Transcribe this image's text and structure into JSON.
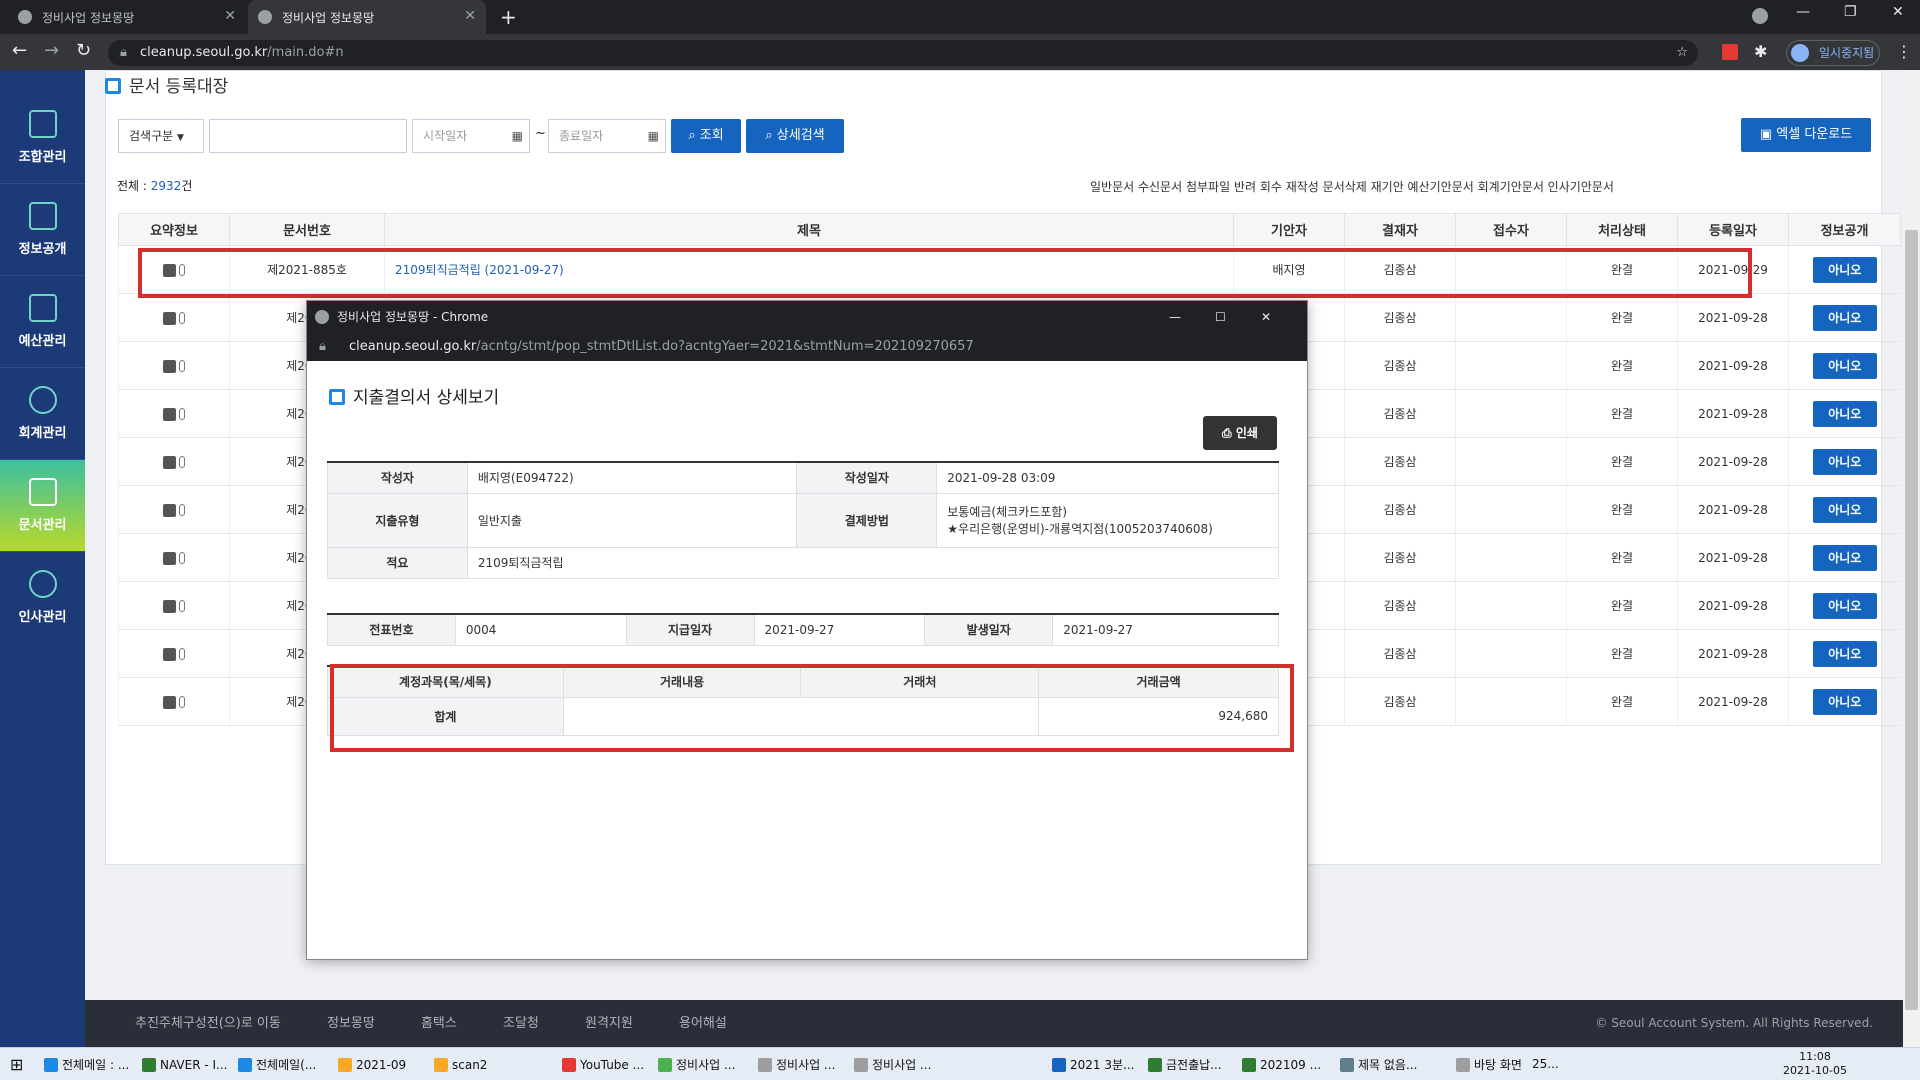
{
  "browser": {
    "tabs": [
      {
        "label": "정비사업 정보몽땅"
      },
      {
        "label": "정비사업 정보몽땅"
      }
    ],
    "url_host": "cleanup.seoul.go.kr",
    "url_path": "/main.do#n",
    "profile_label": "일시중지됨"
  },
  "sidebar": {
    "items": [
      {
        "label": "조합관리"
      },
      {
        "label": "정보공개"
      },
      {
        "label": "예산관리"
      },
      {
        "label": "회계관리"
      },
      {
        "label": "문서관리"
      },
      {
        "label": "인사관리"
      }
    ]
  },
  "page": {
    "title": "문서 등록대장",
    "search_type_label": "검색구분",
    "start_date_placeholder": "시작일자",
    "range_sep": "~",
    "end_date_placeholder": "종료일자",
    "search_button": "조회",
    "detail_search_button": "상세검색",
    "excel_button": "엑셀 다운로드",
    "total_prefix": "전체 : ",
    "total_count": "2932",
    "total_suffix": "건",
    "legend": "일반문서  수신문서  첨부파일  반려  회수  재작성  문서삭제  재기안  예산기안문서  회계기안문서  인사기안문서"
  },
  "table": {
    "headers": [
      "요약정보",
      "문서번호",
      "제목",
      "기안자",
      "결재자",
      "접수자",
      "처리상태",
      "등록일자",
      "정보공개"
    ],
    "rows": [
      {
        "doc_no": "제2021-885호",
        "title": "2109퇴직금적립 (2021-09-27)",
        "drafter": "배지영",
        "approver": "김종삼",
        "receiver": "",
        "status": "완결",
        "date": "2021-09-29",
        "public": "아니오"
      },
      {
        "doc_no": "제2021",
        "title": "",
        "drafter": "",
        "approver": "김종삼",
        "receiver": "",
        "status": "완결",
        "date": "2021-09-28",
        "public": "아니오"
      },
      {
        "doc_no": "제2021",
        "title": "",
        "drafter": "",
        "approver": "김종삼",
        "receiver": "",
        "status": "완결",
        "date": "2021-09-28",
        "public": "아니오"
      },
      {
        "doc_no": "제2021",
        "title": "",
        "drafter": "",
        "approver": "김종삼",
        "receiver": "",
        "status": "완결",
        "date": "2021-09-28",
        "public": "아니오"
      },
      {
        "doc_no": "제2021",
        "title": "",
        "drafter": "",
        "approver": "김종삼",
        "receiver": "",
        "status": "완결",
        "date": "2021-09-28",
        "public": "아니오"
      },
      {
        "doc_no": "제2021",
        "title": "",
        "drafter": "",
        "approver": "김종삼",
        "receiver": "",
        "status": "완결",
        "date": "2021-09-28",
        "public": "아니오"
      },
      {
        "doc_no": "제2021",
        "title": "",
        "drafter": "",
        "approver": "김종삼",
        "receiver": "",
        "status": "완결",
        "date": "2021-09-28",
        "public": "아니오"
      },
      {
        "doc_no": "제2021",
        "title": "",
        "drafter": "",
        "approver": "김종삼",
        "receiver": "",
        "status": "완결",
        "date": "2021-09-28",
        "public": "아니오"
      },
      {
        "doc_no": "제2021",
        "title": "",
        "drafter": "",
        "approver": "김종삼",
        "receiver": "",
        "status": "완결",
        "date": "2021-09-28",
        "public": "아니오"
      },
      {
        "doc_no": "제2021",
        "title": "",
        "drafter": "",
        "approver": "김종삼",
        "receiver": "",
        "status": "완결",
        "date": "2021-09-28",
        "public": "아니오"
      }
    ]
  },
  "popup": {
    "window_title": "정비사업 정보몽땅 - Chrome",
    "url_host": "cleanup.seoul.go.kr",
    "url_path": "/acntg/stmt/pop_stmtDtlList.do?acntgYaer=2021&stmtNum=202109270657",
    "heading": "지출결의서 상세보기",
    "print_button": "인쇄",
    "info": {
      "writer_label": "작성자",
      "writer": "배지영(E094722)",
      "write_date_label": "작성일자",
      "write_date": "2021-09-28 03:09",
      "type_label": "지출유형",
      "type": "일반지출",
      "pay_method_label": "결제방법",
      "pay_method_line1": "보통예금(체크카드포함)",
      "pay_method_line2": "★우리은행(운영비)-개룡역지점(1005203740608)",
      "memo_label": "적요",
      "memo": "2109퇴직금적립"
    },
    "slip": {
      "slip_no_label": "전표번호",
      "slip_no": "0004",
      "pay_date_label": "지급일자",
      "pay_date": "2021-09-27",
      "occur_date_label": "발생일자",
      "occur_date": "2021-09-27"
    },
    "items": {
      "headers": [
        "계정과목(목/세목)",
        "거래내용",
        "거래처",
        "거래금액"
      ],
      "total_label": "합계",
      "total_amount": "924,680"
    }
  },
  "footer": {
    "links": [
      "추진주체구성전(으)로 이동",
      "정보몽땅",
      "홈택스",
      "조달청",
      "원격지원",
      "용어해설"
    ],
    "copyright": "© Seoul Account System. All Rights Reserved."
  },
  "taskbar": {
    "items": [
      "전체메일 : ...",
      "NAVER - I...",
      "전체메일(...",
      "2021-09",
      "scan2",
      "YouTube ...",
      "정비사업 ...",
      "정비사업 ...",
      "정비사업 ...",
      "2021 3분...",
      "금전출납...",
      "202109 ...",
      "제목 없음...",
      "바탕 화면"
    ],
    "tray_text": "25...",
    "time": "11:08",
    "date": "2021-10-05"
  },
  "colors": {
    "sidebar": "#1d3a78",
    "accent_blue": "#1565c0",
    "highlight_red": "#d32f2f"
  }
}
